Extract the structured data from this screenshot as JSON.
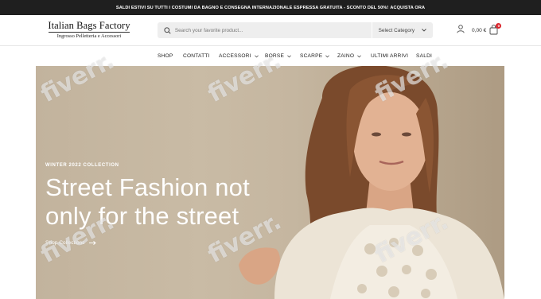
{
  "announcement": {
    "text": "SALDI ESTIVI SU TUTTI I COSTUMI DA BAGNO E CONSEGNA INTERNAZIONALE ESPRESSA GRATUITA - SCONTO DEL 50%!",
    "link": "ACQUISTA ORA"
  },
  "logo": {
    "title": "Italian Bags Factory",
    "subtitle": "Ingrosso Pelletteria e Accessori"
  },
  "search": {
    "placeholder": "Search your favorite product...",
    "category": "Select Category"
  },
  "cart": {
    "total": "0,00 €",
    "count": "0"
  },
  "nav": {
    "items": [
      {
        "label": "SHOP"
      },
      {
        "label": "CONTATTI"
      },
      {
        "label": "ACCESSORI"
      },
      {
        "label": "BORSE"
      },
      {
        "label": "SCARPE"
      },
      {
        "label": "ZAINO"
      },
      {
        "label": "ULTIMI ARRIVI"
      },
      {
        "label": "SALDI"
      }
    ]
  },
  "hero": {
    "eyebrow": "WINTER 2022 COLLECTION",
    "title_line1": "Street Fashion not",
    "title_line2": "only for the street",
    "cta": "Shop Collections"
  },
  "watermark": {
    "text": "fiverr."
  },
  "colors": {
    "topbar": "#1f1f1f",
    "badge": "#d9242b",
    "search_bg": "#eeeeee",
    "hero_bg": "#c5b6a0"
  }
}
